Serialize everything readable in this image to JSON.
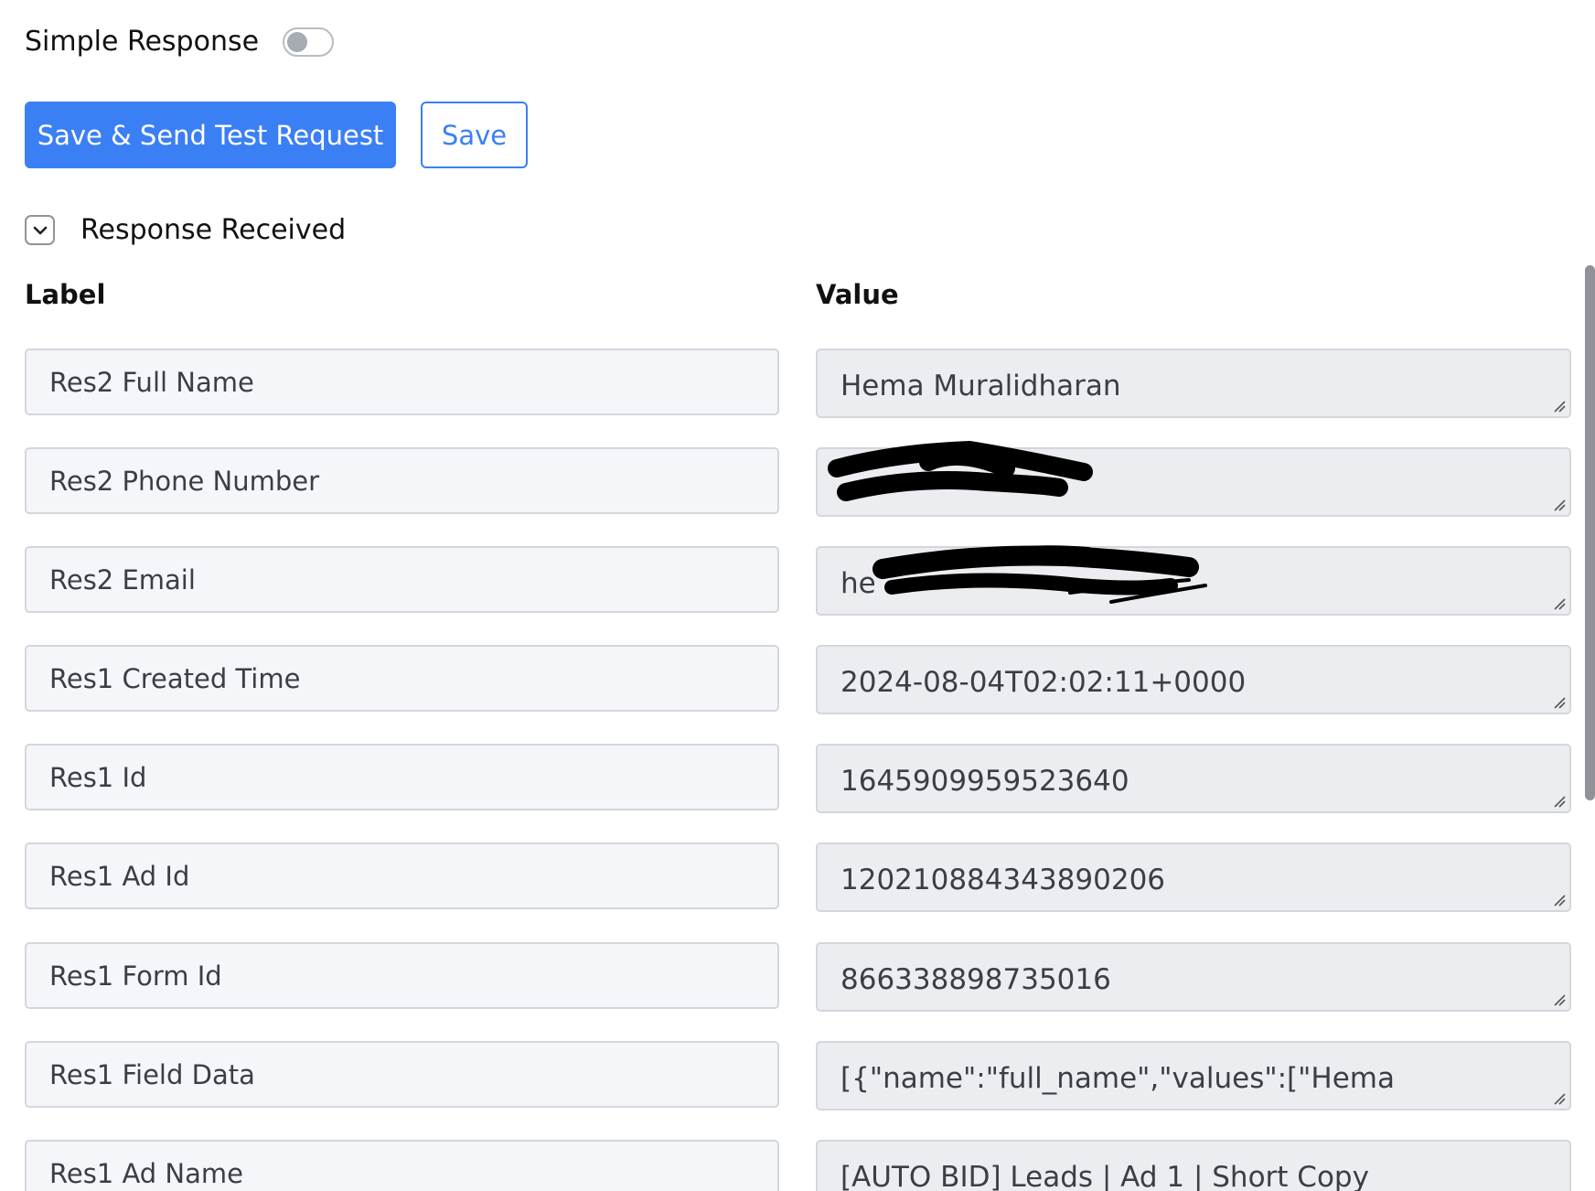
{
  "simple_response": {
    "label": "Simple Response",
    "enabled": false
  },
  "buttons": {
    "save_send_label": "Save & Send Test Request",
    "save_label": "Save"
  },
  "response_section": {
    "title": "Response Received",
    "expanded": true
  },
  "columns": {
    "label": "Label",
    "value": "Value"
  },
  "rows": [
    {
      "label": "Res2 Full Name",
      "value": "Hema Muralidharan"
    },
    {
      "label": "Res2 Phone Number",
      "value": ""
    },
    {
      "label": "Res2 Email",
      "value": "he"
    },
    {
      "label": "Res1 Created Time",
      "value": "2024-08-04T02:02:11+0000"
    },
    {
      "label": "Res1 Id",
      "value": "1645909959523640"
    },
    {
      "label": "Res1 Ad Id",
      "value": "120210884343890206"
    },
    {
      "label": "Res1 Form Id",
      "value": "866338898735016"
    },
    {
      "label": "Res1 Field Data",
      "value": "[{\"name\":\"full_name\",\"values\":[\"Hema"
    },
    {
      "label": "Res1 Ad Name",
      "value": "[AUTO BID] Leads | Ad 1 | Short Copy"
    }
  ],
  "colors": {
    "primary": "#3b7ff5",
    "field_bg": "#f4f6f9",
    "value_bg": "#ebedf1",
    "border": "#d3d7dc"
  },
  "icons": {
    "toggle": "toggle-switch-icon",
    "expand": "chevron-down-icon",
    "resize": "resize-handle-icon"
  }
}
